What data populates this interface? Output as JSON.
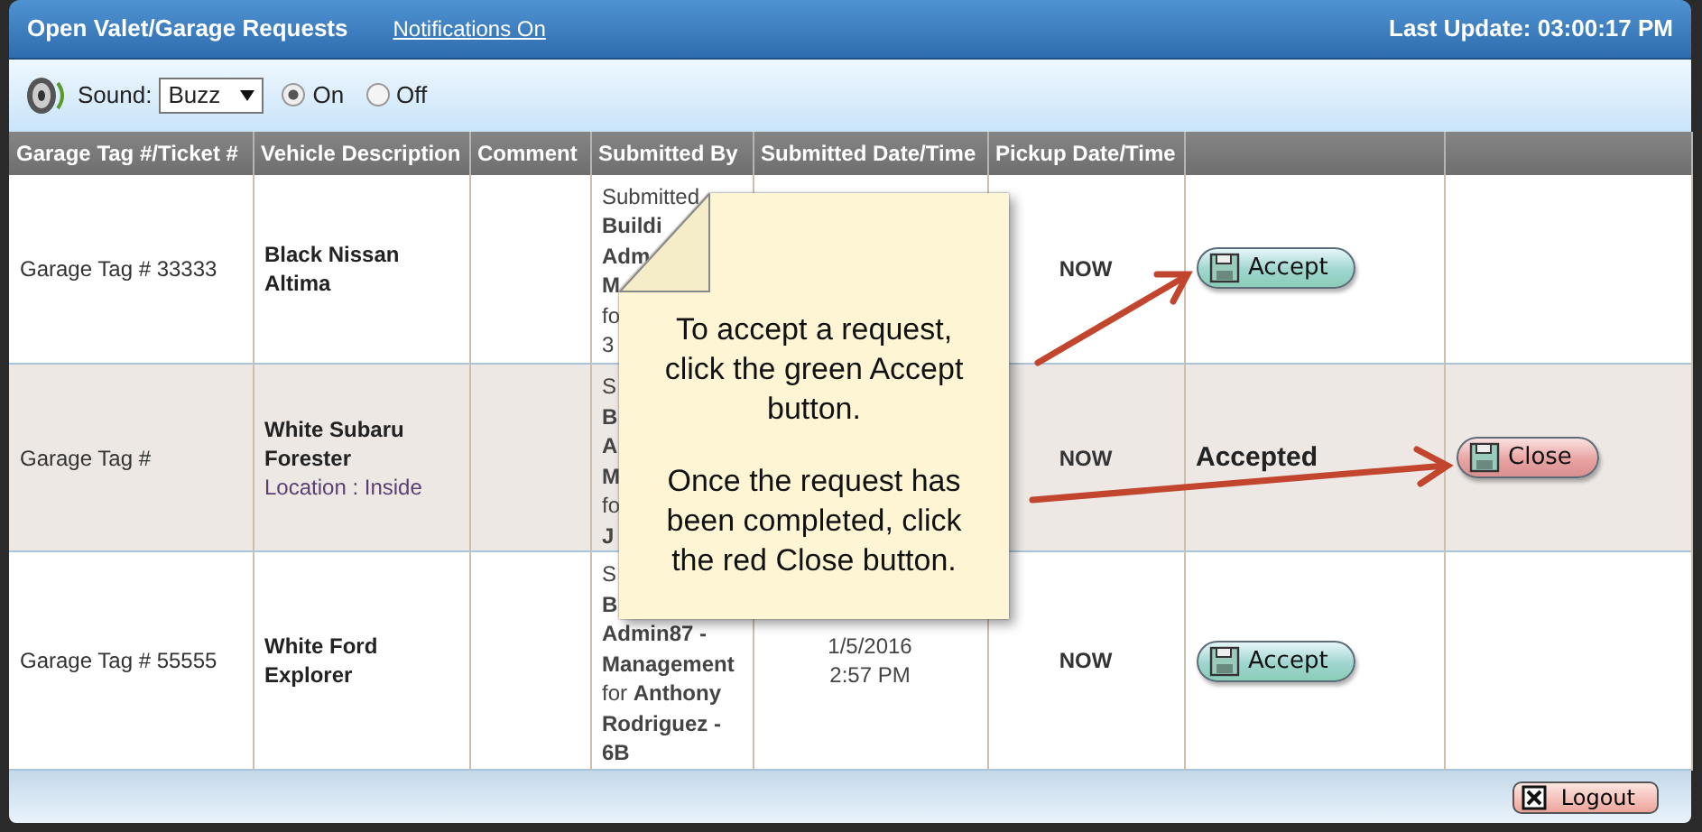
{
  "header": {
    "title": "Open Valet/Garage Requests",
    "link": "Notifications On",
    "last_update": "Last Update: 03:00:17 PM"
  },
  "toolbar": {
    "sound_label": "Sound:",
    "sound_value": "Buzz",
    "options": [
      {
        "label": "On",
        "selected": true
      },
      {
        "label": "Off",
        "selected": false
      }
    ]
  },
  "table": {
    "columns": [
      "Garage Tag #/Ticket #",
      "Vehicle Description",
      "Comment",
      "Submitted By",
      "Submitted Date/Time",
      "Pickup Date/Time"
    ],
    "rows": [
      {
        "selected": false,
        "tag": "Garage Tag # 33333",
        "vehicle": [
          "Black Nissan",
          "Altima"
        ],
        "submitted_by": [
          "Submitted",
          "**Buildi**",
          "**Adm**",
          "**M**",
          "fo",
          "3"
        ],
        "submitted_at": [],
        "pickup": "NOW",
        "status": {
          "kind": "accept",
          "label": "Accept"
        }
      },
      {
        "selected": true,
        "tag": "Garage Tag #",
        "vehicle": [
          "White Subaru",
          "Forester"
        ],
        "location": "Location : Inside",
        "submitted_by": [
          "S",
          "**B**",
          "**A**",
          "**M**",
          "fo",
          "**J**"
        ],
        "submitted_at": [],
        "pickup": "NOW",
        "status": {
          "kind": "accepted",
          "label": "Accepted"
        },
        "close": "Close"
      },
      {
        "selected": false,
        "tag": "Garage Tag # 55555",
        "vehicle": [
          "White Ford",
          "Explorer"
        ],
        "submitted_by": [
          "S",
          "**B**",
          "**Admin87 -**",
          "**Management**",
          "for **Anthony**",
          "**Rodriguez -**",
          "**6B**"
        ],
        "submitted_at": [
          "1/5/2016",
          "2:57 PM"
        ],
        "pickup": "NOW",
        "status": {
          "kind": "accept",
          "label": "Accept"
        }
      }
    ]
  },
  "callout": {
    "paragraphs": [
      "To accept a request, click the green Accept button.",
      "Once the request has been completed, click the red Close button."
    ]
  },
  "footer": {
    "logout": "Logout"
  }
}
